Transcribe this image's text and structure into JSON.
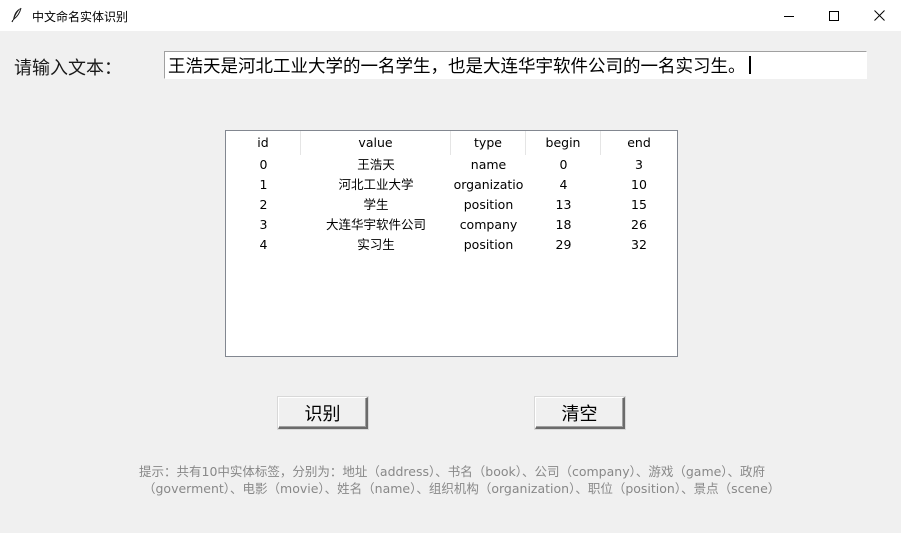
{
  "window": {
    "title": "中文命名实体识别",
    "app_icon": "feather-icon",
    "controls": [
      "minimize-icon",
      "maximize-icon",
      "close-icon"
    ]
  },
  "form": {
    "input_label": "请输入文本：",
    "input_value": "王浩天是河北工业大学的一名学生，也是大连华宇软件公司的一名实习生。"
  },
  "table": {
    "columns": [
      "id",
      "value",
      "type",
      "begin",
      "end"
    ],
    "rows": [
      {
        "id": "0",
        "value": "王浩天",
        "type": "name",
        "begin": "0",
        "end": "3"
      },
      {
        "id": "1",
        "value": "河北工业大学",
        "type": "organizatio",
        "begin": "4",
        "end": "10"
      },
      {
        "id": "2",
        "value": "学生",
        "type": "position",
        "begin": "13",
        "end": "15"
      },
      {
        "id": "3",
        "value": "大连华宇软件公司",
        "type": "company",
        "begin": "18",
        "end": "26"
      },
      {
        "id": "4",
        "value": "实习生",
        "type": "position",
        "begin": "29",
        "end": "32"
      }
    ]
  },
  "buttons": {
    "recognize": "识别",
    "clear": "清空"
  },
  "hint": {
    "line1": "提示：共有10中实体标签，分别为：地址（address）、书名（book）、公司（company）、游戏（game）、政府",
    "line2": "（goverment）、电影（movie）、姓名（name）、组织机构（organization）、职位（position）、景点（scene）"
  }
}
